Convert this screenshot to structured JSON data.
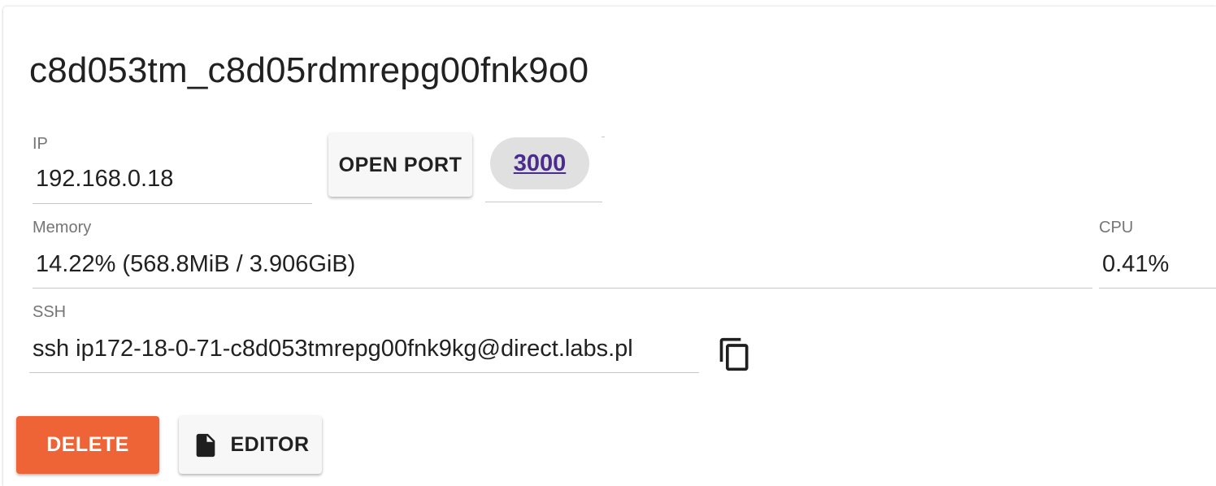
{
  "container": {
    "name": "c8d053tm_c8d05rdmrepg00fnk9o0"
  },
  "ip": {
    "label": "IP",
    "value": "192.168.0.18"
  },
  "open_port_button": "OPEN PORT",
  "ports": [
    "3000"
  ],
  "memory": {
    "label": "Memory",
    "value": "14.22% (568.8MiB / 3.906GiB)"
  },
  "cpu": {
    "label": "CPU",
    "value": "0.41%"
  },
  "ssh": {
    "label": "SSH",
    "value": "ssh ip172-18-0-71-c8d053tmrepg00fnk9kg@direct.labs.pl",
    "copy_icon": "copy-icon"
  },
  "actions": {
    "delete_label": "DELETE",
    "editor_label": "EDITOR",
    "editor_icon": "file-icon"
  },
  "colors": {
    "delete_bg": "#ee6436",
    "port_link": "#4a2c8e",
    "chip_bg": "#e0e0e0"
  }
}
